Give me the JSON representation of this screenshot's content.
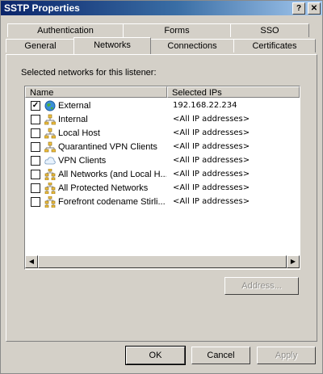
{
  "window": {
    "title": "SSTP Properties",
    "help_glyph": "?",
    "close_glyph": "✕"
  },
  "tabs_back": [
    "Authentication",
    "Forms",
    "SSO"
  ],
  "tabs_front": [
    "General",
    "Networks",
    "Connections",
    "Certificates"
  ],
  "active_tab": "Networks",
  "panel": {
    "label": "Selected networks for this listener:"
  },
  "list": {
    "columns": [
      "Name",
      "Selected IPs"
    ],
    "rows": [
      {
        "name": "External",
        "ip": "192.168.22.234",
        "checked": true,
        "icon": "globe-icon"
      },
      {
        "name": "Internal",
        "ip": "<All IP addresses>",
        "checked": false,
        "icon": "network-icon"
      },
      {
        "name": "Local Host",
        "ip": "<All IP addresses>",
        "checked": false,
        "icon": "network-icon"
      },
      {
        "name": "Quarantined VPN Clients",
        "ip": "<All IP addresses>",
        "checked": false,
        "icon": "network-icon"
      },
      {
        "name": "VPN Clients",
        "ip": "<All IP addresses>",
        "checked": false,
        "icon": "cloud-icon"
      },
      {
        "name": "All Networks (and Local H...",
        "ip": "<All IP addresses>",
        "checked": false,
        "icon": "network-set-icon"
      },
      {
        "name": "All Protected Networks",
        "ip": "<All IP addresses>",
        "checked": false,
        "icon": "network-set-icon"
      },
      {
        "name": "Forefront codename Stirli...",
        "ip": "<All IP addresses>",
        "checked": false,
        "icon": "network-set-icon"
      }
    ],
    "check_glyph": "✓",
    "scroll_left_glyph": "◀",
    "scroll_right_glyph": "▶"
  },
  "buttons": {
    "address": "Address...",
    "ok": "OK",
    "cancel": "Cancel",
    "apply": "Apply"
  }
}
